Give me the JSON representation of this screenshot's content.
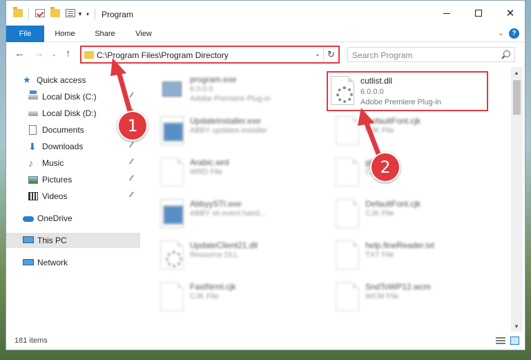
{
  "window": {
    "title": "Program"
  },
  "ribbon": {
    "tabs": [
      "File",
      "Home",
      "Share",
      "View"
    ],
    "help": "?"
  },
  "address": {
    "path": "C:\\Program Files\\Program Directory",
    "search_placeholder": "Search Program"
  },
  "sidebar": {
    "items": [
      {
        "label": "Quick access"
      },
      {
        "label": "Local Disk (C:)"
      },
      {
        "label": "Local Disk (D:)"
      },
      {
        "label": "Documents"
      },
      {
        "label": "Downloads"
      },
      {
        "label": "Music"
      },
      {
        "label": "Pictures"
      },
      {
        "label": "Videos"
      },
      {
        "label": "OneDrive"
      },
      {
        "label": "This PC"
      },
      {
        "label": "Network"
      }
    ]
  },
  "files": [
    {
      "name": "program.exe",
      "meta1": "6.0.0.0",
      "meta2": "Adobe Premiere Plug-in"
    },
    {
      "name": "UpdateInstaller.exe",
      "meta1": "ABBY updates installer",
      "meta2": ""
    },
    {
      "name": "Arabic.wrd",
      "meta1": "WRD File",
      "meta2": ""
    },
    {
      "name": "AbbyySTI.exe",
      "meta1": "ABBY sti event hand...",
      "meta2": ""
    },
    {
      "name": "UpdateClient21.dll",
      "meta1": "Resource DLL",
      "meta2": ""
    },
    {
      "name": "FastNrml.cjk",
      "meta1": "CJK File",
      "meta2": ""
    },
    {
      "name": "cutlist.dll",
      "meta1": "6.0.0.0",
      "meta2": "Adobe Premiere Plug-in"
    },
    {
      "name": "DefaultFont.cjk",
      "meta1": "CJK File",
      "meta2": ""
    },
    {
      "name": "glyph",
      "meta1": "CJK File",
      "meta2": ""
    },
    {
      "name": "DefaultFont.cjk",
      "meta1": "CJK File",
      "meta2": ""
    },
    {
      "name": "help.fineReader.txt",
      "meta1": "TXT File",
      "meta2": ""
    },
    {
      "name": "SndToWP12.wcm",
      "meta1": "WCM File",
      "meta2": ""
    }
  ],
  "status": {
    "item_count": "181 items"
  },
  "callouts": [
    "1",
    "2"
  ],
  "colors": {
    "accent": "#1979ca",
    "highlight": "#e0393e"
  }
}
